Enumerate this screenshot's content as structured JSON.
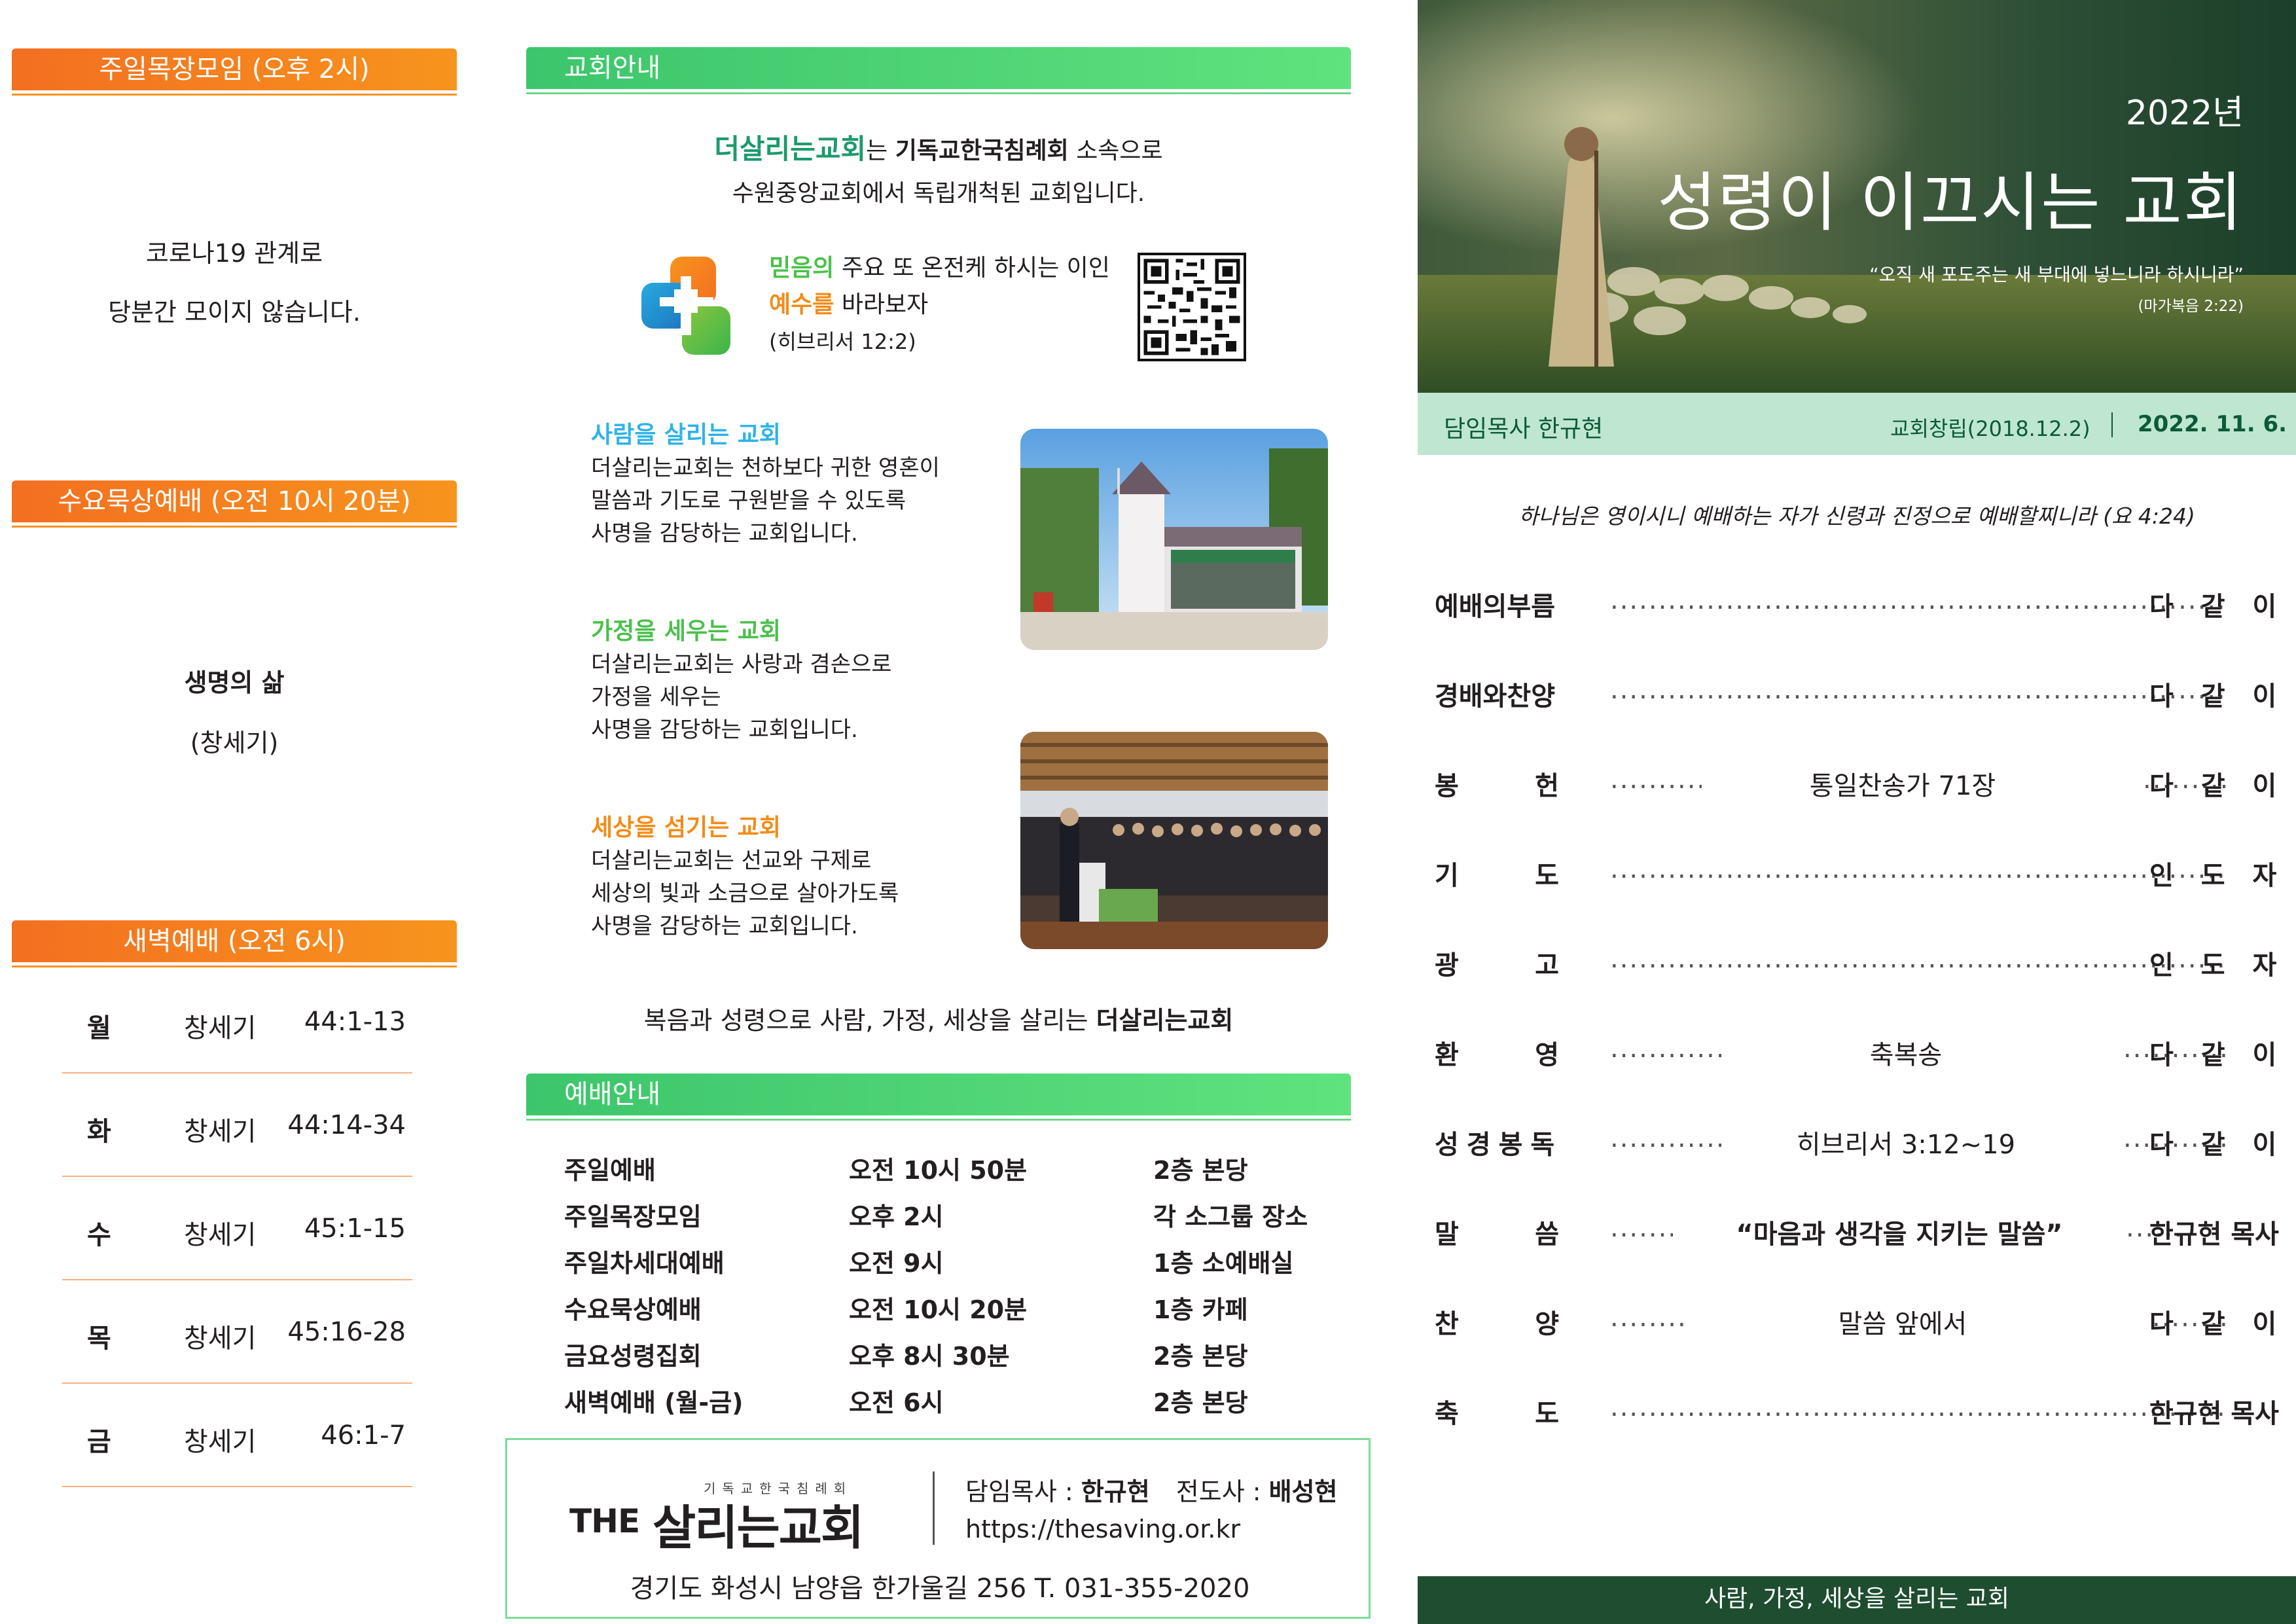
{
  "left": {
    "sunday_group": {
      "title": "주일목장모임 (오후 2시)",
      "lines": [
        "코로나19 관계로",
        "당분간 모이지 않습니다."
      ]
    },
    "wednesday": {
      "title": "수요묵상예배 (오전 10시 20분)",
      "subject": "생명의 삶",
      "book": "(창세기)"
    },
    "dawn": {
      "title": "새벽예배 (오전 6시)",
      "rows": [
        {
          "day": "월",
          "book": "창세기",
          "verse": "44:1-13"
        },
        {
          "day": "화",
          "book": "창세기",
          "verse": "44:14-34"
        },
        {
          "day": "수",
          "book": "창세기",
          "verse": "45:1-15"
        },
        {
          "day": "목",
          "book": "창세기",
          "verse": "45:16-28"
        },
        {
          "day": "금",
          "book": "창세기",
          "verse": "46:1-7"
        }
      ]
    }
  },
  "mid": {
    "church_info": {
      "title": "교회안내",
      "church_name": "더살리는교회",
      "line1_a": "는 ",
      "denomination": "기독교한국침례회",
      "line1_b": " 소속으로",
      "line2": "수원중앙교회에서 독립개척된 교회입니다.",
      "verse_hl1": "믿음의",
      "verse_l1": " 주요 또 온전케 하시는 이인",
      "verse_hl2": "예수를",
      "verse_l2": " 바라보자",
      "verse_ref": "(히브리서 12:2)"
    },
    "features": [
      {
        "title": "사람을 살리는 교회",
        "lines": [
          "더살리는교회는 천하보다 귀한 영혼이",
          "말씀과 기도로 구원받을 수 있도록",
          "사명을 감당하는 교회입니다."
        ]
      },
      {
        "title": "가정을 세우는 교회",
        "lines": [
          "더살리는교회는 사랑과 겸손으로",
          "가정을 세우는",
          "사명을 감당하는 교회입니다."
        ]
      },
      {
        "title": "세상을 섬기는 교회",
        "lines": [
          "더살리는교회는 선교와 구제로",
          "세상의 빛과 소금으로 살아가도록",
          "사명을 감당하는 교회입니다."
        ]
      }
    ],
    "slogan_a": "복음과 성령으로 사람, 가정, 세상을 살리는 ",
    "slogan_b": "더살리는교회",
    "worship": {
      "title": "예배안내",
      "rows": [
        {
          "name": "주일예배",
          "time": "오전 10시 50분",
          "place": "2층 본당"
        },
        {
          "name": "주일목장모임",
          "time": "오후 2시",
          "place": "각 소그룹 장소"
        },
        {
          "name": "주일차세대예배",
          "time": "오전 9시",
          "place": "1층 소예배실"
        },
        {
          "name": "수요묵상예배",
          "time": "오전 10시 20분",
          "place": "1층 카페"
        },
        {
          "name": "금요성령집회",
          "time": "오후 8시 30분",
          "place": "2층 본당"
        },
        {
          "name": "새벽예배 (월-금)",
          "time": "오전 6시",
          "place": "2층 본당"
        }
      ]
    },
    "footer": {
      "logo_small": "기독교한국침례회",
      "logo_the": "THE",
      "logo_main": "살리는교회",
      "pastor_label": "담임목사 : ",
      "pastor_name": "한규현",
      "evangelist_label": "전도사 : ",
      "evangelist_name": "배성현",
      "url": "https://thesaving.or.kr",
      "address": "경기도 화성시 남양읍 한가울길 256   T. 031-355-2020"
    }
  },
  "right": {
    "year": "2022년",
    "title": "성령이 이끄시는 교회",
    "quote": "“오직 새 포도주는 새 부대에 넣느니라 하시니라”",
    "quote_ref": "(마가복음 2:22)",
    "pastor_label": "담임목사  한규현",
    "founded": "교회창립(2018.12.2)",
    "date": "2022. 11. 6.",
    "epigraph": "하나님은 영이시니 예배하는 자가 신령과 진정으로 예배할찌니라 (요 4:24)",
    "order": [
      {
        "label": [
          "예배의부름"
        ],
        "middle": "",
        "right": "다 같 이"
      },
      {
        "label": [
          "경배와찬양"
        ],
        "middle": "",
        "right": "다 같 이"
      },
      {
        "label": [
          "봉",
          "헌"
        ],
        "middle": "통일찬송가 71장",
        "right": "다 같 이"
      },
      {
        "label": [
          "기",
          "도"
        ],
        "middle": "",
        "right": "인 도 자"
      },
      {
        "label": [
          "광",
          "고"
        ],
        "middle": "",
        "right": "인 도 자"
      },
      {
        "label": [
          "환",
          "영"
        ],
        "middle": "축복송",
        "right": "다 같 이"
      },
      {
        "label": [
          "성경봉독"
        ],
        "middle": "히브리서 3:12~19",
        "right": "다 같 이"
      },
      {
        "label": [
          "말",
          "씀"
        ],
        "middle": "“마음과 생각을 지키는 말씀”",
        "right": "한규현 목사"
      },
      {
        "label": [
          "찬",
          "양"
        ],
        "middle": "말씀 앞에서",
        "right": "다 같 이"
      },
      {
        "label": [
          "축",
          "도"
        ],
        "middle": "",
        "right": "한규현 목사"
      }
    ],
    "footer": "사람, 가정, 세상을 살리는 교회"
  },
  "colors": {
    "orange": "#f7941d",
    "green": "#3dc56c",
    "dark_green": "#1e4d2f",
    "brand_green": "#1d9a6c"
  },
  "icons": [
    "cross-logo-icon",
    "qr-code-icon"
  ]
}
